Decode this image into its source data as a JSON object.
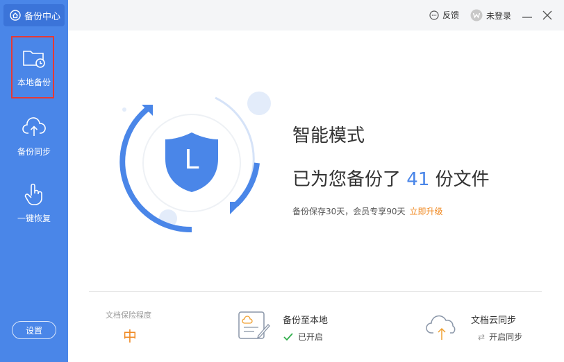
{
  "sidebar": {
    "brand_label": "备份中心",
    "items": [
      {
        "label": "本地备份",
        "icon": "folder-clock-icon",
        "active": true
      },
      {
        "label": "备份同步",
        "icon": "cloud-upload-icon"
      },
      {
        "label": "一键恢复",
        "icon": "hand-pointer-icon"
      }
    ],
    "settings_label": "设置"
  },
  "titlebar": {
    "feedback_label": "反馈",
    "login_label": "未登录",
    "controls": [
      "minimize-icon",
      "close-icon"
    ]
  },
  "main": {
    "shield_letter": "L",
    "mode_title": "智能模式",
    "backup_prefix": "已为您备份了",
    "backup_count": "41",
    "backup_suffix": "份文件",
    "retention_text": "备份保存30天，会员专享90天",
    "upgrade_link": "立即升级"
  },
  "footer": {
    "protection_label": "文档保险程度",
    "protection_value": "中",
    "local_backup_title": "备份至本地",
    "local_backup_status": "已开启",
    "cloud_sync_title": "文档云同步",
    "cloud_sync_action": "开启同步"
  },
  "colors": {
    "sidebar_bg": "#4a86e8",
    "accent": "#4a86e8",
    "warning": "#f08a24",
    "highlight": "#e53935",
    "success": "#2fae4a"
  }
}
